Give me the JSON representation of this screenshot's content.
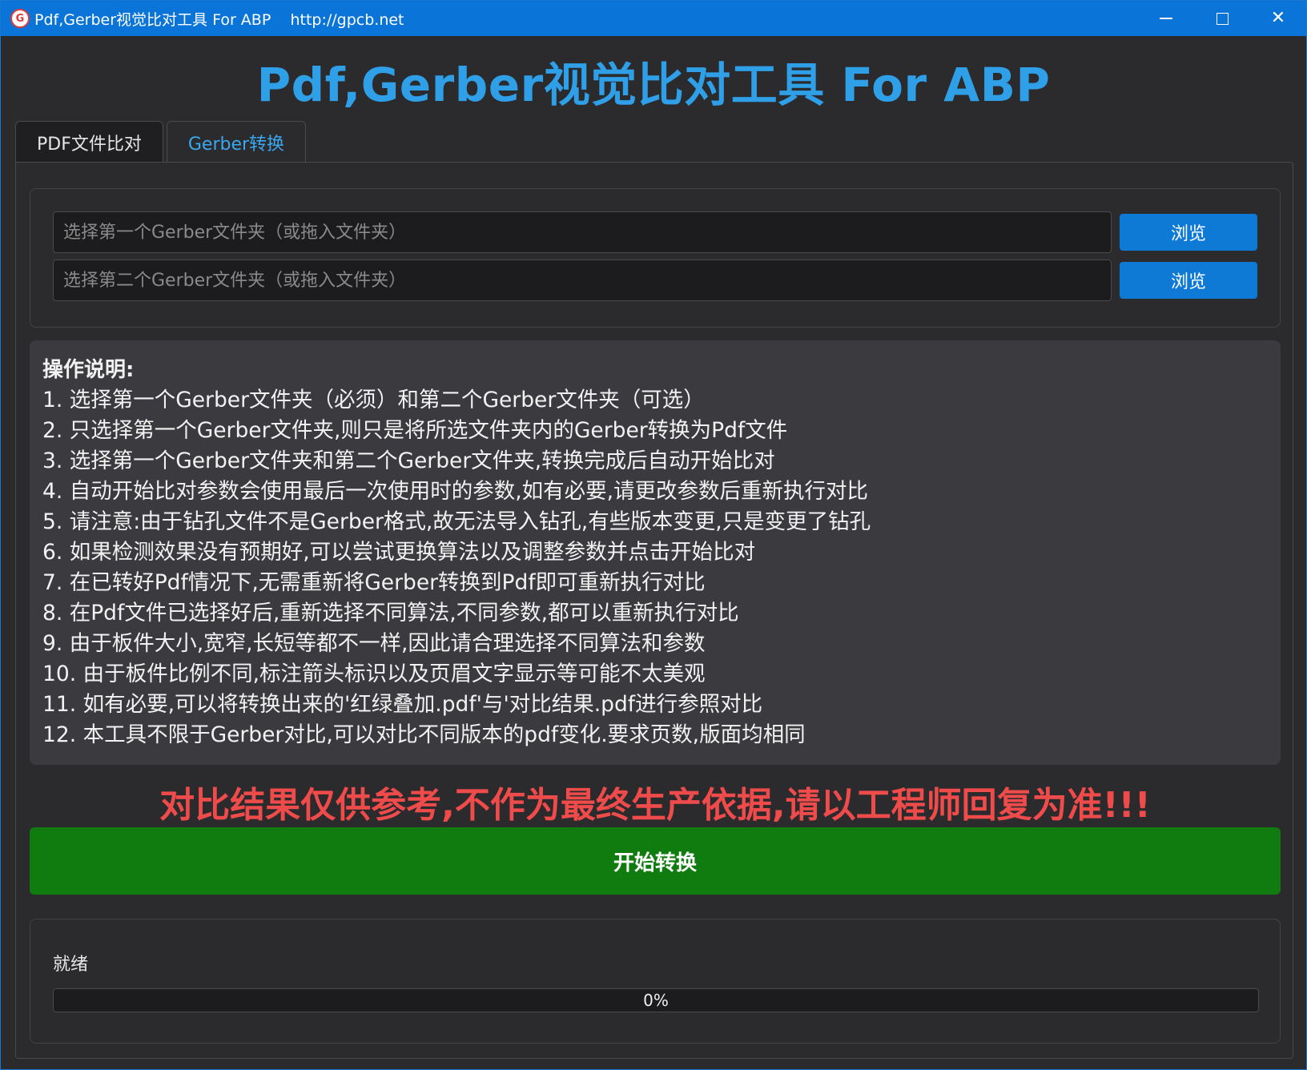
{
  "window": {
    "title": "Pdf,Gerber视觉比对工具 For ABP    http://gpcb.net",
    "icon_glyph": "G",
    "controls": [
      "minimize",
      "maximize",
      "close"
    ]
  },
  "header": {
    "title": "Pdf,Gerber视觉比对工具 For ABP"
  },
  "tabs": [
    {
      "label": "PDF文件比对",
      "active": false
    },
    {
      "label": "Gerber转换",
      "active": true
    }
  ],
  "inputs": {
    "first_folder": {
      "value": "",
      "placeholder": "选择第一个Gerber文件夹（或拖入文件夹）"
    },
    "second_folder": {
      "value": "",
      "placeholder": "选择第二个Gerber文件夹（或拖入文件夹）"
    },
    "browse_label": "浏览"
  },
  "instructions": {
    "title": "操作说明:",
    "lines": [
      "1. 选择第一个Gerber文件夹（必须）和第二个Gerber文件夹（可选）",
      "2. 只选择第一个Gerber文件夹,则只是将所选文件夹内的Gerber转换为Pdf文件",
      "3. 选择第一个Gerber文件夹和第二个Gerber文件夹,转换完成后自动开始比对",
      "4. 自动开始比对参数会使用最后一次使用时的参数,如有必要,请更改参数后重新执行对比",
      "5. 请注意:由于钻孔文件不是Gerber格式,故无法导入钻孔,有些版本变更,只是变更了钻孔",
      "6. 如果检测效果没有预期好,可以尝试更换算法以及调整参数并点击开始比对",
      "7. 在已转好Pdf情况下,无需重新将Gerber转换到Pdf即可重新执行对比",
      "8. 在Pdf文件已选择好后,重新选择不同算法,不同参数,都可以重新执行对比",
      "9. 由于板件大小,宽窄,长短等都不一样,因此请合理选择不同算法和参数",
      "10. 由于板件比例不同,标注箭头标识以及页眉文字显示等可能不太美观",
      "11. 如有必要,可以将转换出来的'红绿叠加.pdf'与'对比结果.pdf进行参照对比",
      "12. 本工具不限于Gerber对比,可以对比不同版本的pdf变化.要求页数,版面均相同"
    ]
  },
  "warning": "对比结果仅供参考,不作为最终生产依据,请以工程师回复为准!!!",
  "start_button": "开始转换",
  "status": {
    "label": "就绪",
    "progress_percent": 0,
    "progress_text": "0%"
  },
  "colors": {
    "titlebar": "#0a74d8",
    "header": "#2f9fe8",
    "warning": "#f04b4b",
    "start_button": "#107c10",
    "browse_button": "#0e7ad6"
  }
}
